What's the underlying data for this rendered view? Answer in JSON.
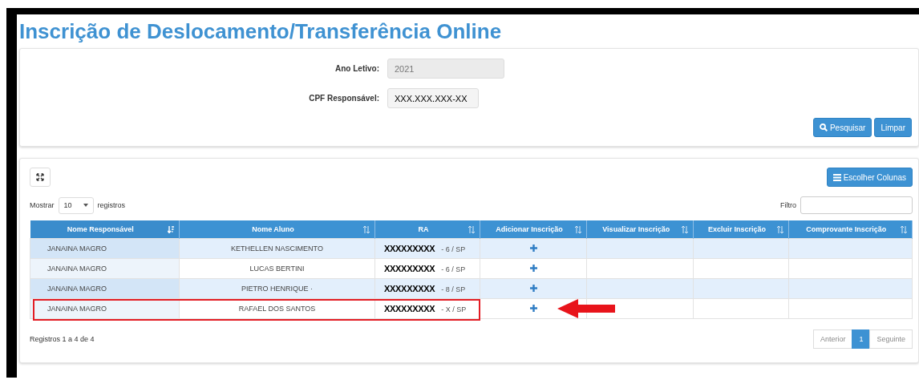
{
  "title": "Inscrição de Deslocamento/Transferência Online",
  "form": {
    "fields": [
      {
        "label": "Ano Letivo:",
        "value": "2021",
        "disabled": true
      },
      {
        "label": "CPF Responsável:",
        "value": "XXX.XXX.XXX-XX",
        "disabled": false
      }
    ],
    "buttons": [
      {
        "label": "Pesquisar",
        "kind": "search"
      },
      {
        "label": "Limpar",
        "kind": "plain"
      }
    ]
  },
  "results": {
    "choose_columns_button": "Escolher Colunas",
    "length": {
      "prefix": "Mostrar",
      "value": "10",
      "suffix": "registros"
    },
    "filter": {
      "label": "Filtro"
    },
    "columns": [
      {
        "label": "Nome Responsável",
        "sorted": true
      },
      {
        "label": "Nome Aluno",
        "sorted": false
      },
      {
        "label": "RA",
        "sorted": false
      },
      {
        "label": "Adicionar Inscrição",
        "sorted": false
      },
      {
        "label": "Visualizar Inscrição",
        "sorted": false
      },
      {
        "label": "Excluir Inscrição",
        "sorted": false
      },
      {
        "label": "Comprovante Inscrição",
        "sorted": false
      }
    ],
    "rows": [
      {
        "responsavel": "JANAINA MAGRO",
        "aluno": "KETHELLEN NASCIMENTO",
        "ra": "XXXXXXXXX",
        "ra_suffix": "- 6 / SP",
        "highlighted": false
      },
      {
        "responsavel": "JANAINA MAGRO",
        "aluno": "LUCAS BERTINI",
        "ra": "XXXXXXXXX",
        "ra_suffix": "- 6 / SP",
        "highlighted": false
      },
      {
        "responsavel": "JANAINA MAGRO",
        "aluno": "PIETRO HENRIQUE ·",
        "ra": "XXXXXXXXX",
        "ra_suffix": "- 8 / SP",
        "highlighted": false
      },
      {
        "responsavel": "JANAINA MAGRO",
        "aluno": "RAFAEL DOS SANTOS",
        "ra": "XXXXXXXXX",
        "ra_suffix": "- X / SP",
        "highlighted": true
      }
    ],
    "info": "Registros 1 a 4 de 4",
    "pagination": [
      {
        "label": "Anterior",
        "selected": false
      },
      {
        "label": "1",
        "selected": true
      },
      {
        "label": "Seguinte",
        "selected": false
      }
    ]
  }
}
